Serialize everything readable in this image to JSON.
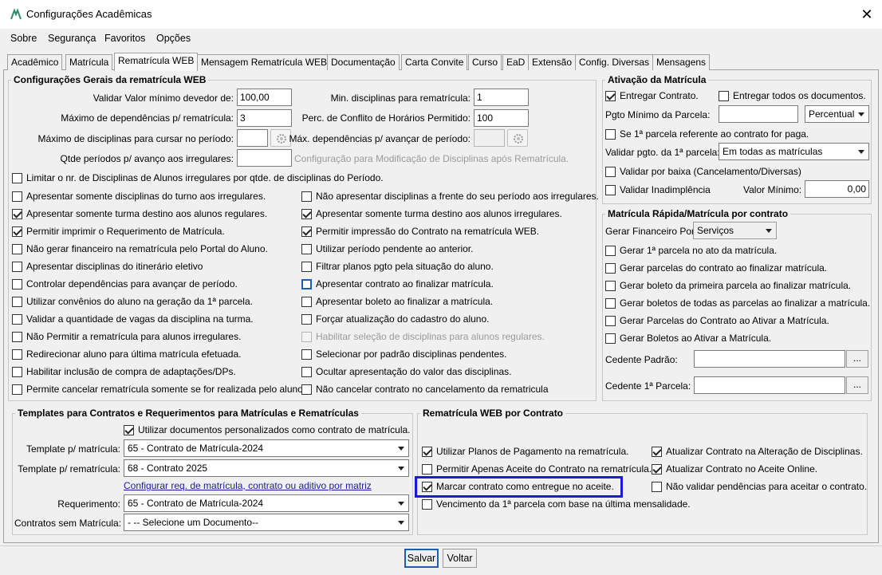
{
  "window": {
    "title": "Configurações Acadêmicas",
    "close_glyph": "✕"
  },
  "menu": [
    "Sobre",
    "Segurança",
    "Favoritos",
    "Opções"
  ],
  "tabs": [
    "Acadêmico",
    "Matrícula",
    "Rematrícula WEB",
    "Mensagem Rematrícula WEB",
    "Documentação",
    "Carta Convite",
    "Curso",
    "EaD",
    "Extensão",
    "Config. Diversas",
    "Mensagens"
  ],
  "active_tab": "Rematrícula WEB",
  "general": {
    "title": "Configurações Gerais da rematrícula WEB",
    "fields": {
      "valor_min_label": "Validar Valor mínimo devedor de:",
      "valor_min_value": "100,00",
      "max_dep_label": "Máximo de dependências p/ rematrícula:",
      "max_dep_value": "3",
      "max_disc_label": "Máximo de disciplinas para cursar no período:",
      "max_disc_value": "",
      "qtde_periodos_label": "Qtde períodos p/ avanço aos irregulares:",
      "qtde_periodos_value": "",
      "min_disc_label": "Min. disciplinas para rematrícula:",
      "min_disc_value": "1",
      "perc_conflito_label": "Perc. de Conflito de Horários Permitido:",
      "perc_conflito_value": "100",
      "max_dep_avanco_label": "Máx. dependências p/ avançar de período:",
      "config_mod_disabled_label": "Configuração para Modificação de Disciplinas após Rematrícula."
    },
    "limit_checkbox": "Limitar o nr. de Disciplinas de Alunos irregulares por qtde. de disciplinas do Período.",
    "left_checks": [
      {
        "label": "Apresentar somente disciplinas do turno aos irregulares.",
        "checked": false
      },
      {
        "label": "Apresentar somente turma destino aos alunos regulares.",
        "checked": true
      },
      {
        "label": "Permitir imprimir o Requerimento de Matrícula.",
        "checked": true
      },
      {
        "label": "Não gerar financeiro na rematrícula pelo Portal do Aluno.",
        "checked": false
      },
      {
        "label": "Apresentar disciplinas do itinerário eletivo",
        "checked": false
      },
      {
        "label": "Controlar dependências para avançar de período.",
        "checked": false
      },
      {
        "label": "Utilizar convênios do aluno na geração da 1ª parcela.",
        "checked": false
      },
      {
        "label": "Validar a quantidade de vagas da disciplina na turma.",
        "checked": false
      },
      {
        "label": "Não Permitir a rematrícula para alunos irregulares.",
        "checked": false
      },
      {
        "label": "Redirecionar aluno para última matrícula efetuada.",
        "checked": false
      },
      {
        "label": "Habilitar inclusão de compra de adaptações/DPs.",
        "checked": false
      },
      {
        "label": "Permite cancelar rematrícula somente se for realizada pelo aluno.",
        "checked": false
      }
    ],
    "right_checks": [
      {
        "label": "Não apresentar disciplinas a frente do seu período aos irregulares.",
        "checked": false
      },
      {
        "label": "Apresentar somente turma destino aos alunos irregulares.",
        "checked": true
      },
      {
        "label": "Permitir impressão do Contrato na rematrícula WEB.",
        "checked": true
      },
      {
        "label": "Utilizar período pendente ao anterior.",
        "checked": false
      },
      {
        "label": "Filtrar planos pgto pela situação do aluno.",
        "checked": false
      },
      {
        "label": "Apresentar contrato ao finalizar matrícula.",
        "checked": false,
        "focus": true
      },
      {
        "label": "Apresentar boleto ao finalizar a matrícula.",
        "checked": false
      },
      {
        "label": "Forçar atualização do cadastro do aluno.",
        "checked": false
      },
      {
        "label": "Habilitar seleção de disciplinas para alunos regulares.",
        "checked": false,
        "disabled": true
      },
      {
        "label": "Selecionar por padrão disciplinas pendentes.",
        "checked": false
      },
      {
        "label": "Ocultar apresentação do valor das disciplinas.",
        "checked": false
      },
      {
        "label": "Não cancelar contrato no cancelamento da rematricula",
        "checked": false
      }
    ]
  },
  "ativacao": {
    "title": "Ativação da Matrícula",
    "entregar_contrato": "Entregar Contrato.",
    "entregar_todos": "Entregar todos os documentos.",
    "pgto_minimo_label": "Pgto Mínimo da Parcela:",
    "pgto_minimo_value": "",
    "pgto_tipo": "Percentual",
    "se_primeira": "Se 1ª parcela referente ao contrato for paga.",
    "validar_pgto_label": "Validar pgto. da 1ª parcela:",
    "validar_pgto_value": "Em todas as matrículas",
    "validar_baixa": "Validar por baixa (Cancelamento/Diversas)",
    "validar_inadimplencia": "Validar Inadimplência",
    "valor_minimo_label": "Valor Mínimo:",
    "valor_minimo_value": "0,00"
  },
  "rapida": {
    "title": "Matrícula Rápida/Matrícula por contrato",
    "gerar_fin_label": "Gerar Financeiro Por:",
    "gerar_fin_value": "Serviços",
    "checks": [
      "Gerar 1ª parcela no ato da matrícula.",
      "Gerar parcelas do contrato ao finalizar matrícula.",
      "Gerar boleto da primeira parcela ao finalizar matrícula.",
      "Gerar boletos de todas as parcelas ao finalizar a matrícula.",
      "Gerar Parcelas do Contrato ao Ativar a Matrícula.",
      "Gerar Boletos ao Ativar a Matrícula."
    ],
    "cedente_label": "Cedente Padrão:",
    "cedente_value": "",
    "cedente1_label": "Cedente 1ª Parcela:",
    "cedente1_value": "",
    "dots": "..."
  },
  "templates": {
    "title": "Templates para Contratos e Requerimentos para Matrículas e Rematrículas",
    "utilizar_docs": "Utilizar documentos personalizados como contrato de matrícula.",
    "tpl_matricula_label": "Template p/ matrícula:",
    "tpl_matricula_value": "65 - Contrato de Matrícula-2024",
    "tpl_rematricula_label": "Template p/ rematrícula:",
    "tpl_rematricula_value": "68 - Contrato 2025",
    "config_link": "Configurar req. de matrícula, contrato ou aditivo por matriz",
    "requerimento_label": "Requerimento:",
    "requerimento_value": "65 - Contrato de Matrícula-2024",
    "contratos_sem_label": "Contratos sem Matrícula:",
    "contratos_sem_value": "- -- Selecione um Documento--"
  },
  "webcontrato": {
    "title": "Rematrícula WEB por Contrato",
    "utilizar_planos": "Utilizar Planos de Pagamento na rematrícula.",
    "permitir_aceite": "Permitir Apenas Aceite do Contrato na rematrícula.",
    "marcar_entregue": "Marcar contrato como entregue no aceite.",
    "vencimento": "Vencimento da 1ª parcela com base na última mensalidade.",
    "atualizar_alteracao": "Atualizar Contrato na Alteração de Disciplinas.",
    "atualizar_aceite": "Atualizar Contrato no Aceite Online.",
    "nao_validar": "Não validar pendências para aceitar o contrato."
  },
  "buttons": {
    "salvar": "Salvar",
    "voltar": "Voltar"
  },
  "colors": {
    "accent": "#1a5fb4",
    "highlight": "#1a1ad8",
    "link": "#1a1aa6"
  }
}
